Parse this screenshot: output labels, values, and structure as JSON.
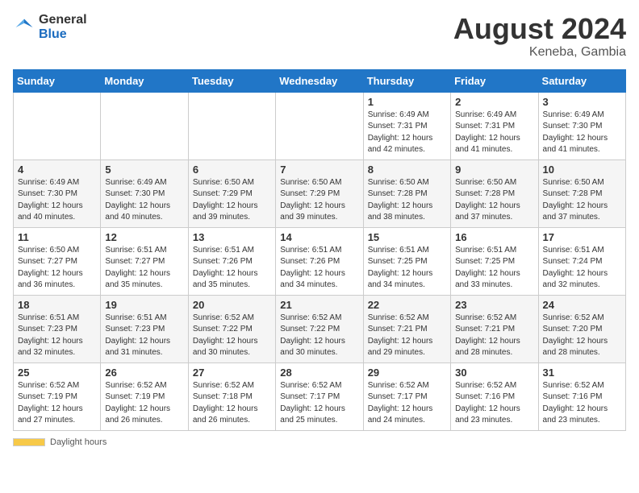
{
  "header": {
    "logo_general": "General",
    "logo_blue": "Blue",
    "month_year": "August 2024",
    "location": "Keneba, Gambia"
  },
  "days_of_week": [
    "Sunday",
    "Monday",
    "Tuesday",
    "Wednesday",
    "Thursday",
    "Friday",
    "Saturday"
  ],
  "footer_label": "Daylight hours",
  "weeks": [
    [
      {
        "day": "",
        "text": ""
      },
      {
        "day": "",
        "text": ""
      },
      {
        "day": "",
        "text": ""
      },
      {
        "day": "",
        "text": ""
      },
      {
        "day": "1",
        "text": "Sunrise: 6:49 AM\nSunset: 7:31 PM\nDaylight: 12 hours and 42 minutes."
      },
      {
        "day": "2",
        "text": "Sunrise: 6:49 AM\nSunset: 7:31 PM\nDaylight: 12 hours and 41 minutes."
      },
      {
        "day": "3",
        "text": "Sunrise: 6:49 AM\nSunset: 7:30 PM\nDaylight: 12 hours and 41 minutes."
      }
    ],
    [
      {
        "day": "4",
        "text": "Sunrise: 6:49 AM\nSunset: 7:30 PM\nDaylight: 12 hours and 40 minutes."
      },
      {
        "day": "5",
        "text": "Sunrise: 6:49 AM\nSunset: 7:30 PM\nDaylight: 12 hours and 40 minutes."
      },
      {
        "day": "6",
        "text": "Sunrise: 6:50 AM\nSunset: 7:29 PM\nDaylight: 12 hours and 39 minutes."
      },
      {
        "day": "7",
        "text": "Sunrise: 6:50 AM\nSunset: 7:29 PM\nDaylight: 12 hours and 39 minutes."
      },
      {
        "day": "8",
        "text": "Sunrise: 6:50 AM\nSunset: 7:28 PM\nDaylight: 12 hours and 38 minutes."
      },
      {
        "day": "9",
        "text": "Sunrise: 6:50 AM\nSunset: 7:28 PM\nDaylight: 12 hours and 37 minutes."
      },
      {
        "day": "10",
        "text": "Sunrise: 6:50 AM\nSunset: 7:28 PM\nDaylight: 12 hours and 37 minutes."
      }
    ],
    [
      {
        "day": "11",
        "text": "Sunrise: 6:50 AM\nSunset: 7:27 PM\nDaylight: 12 hours and 36 minutes."
      },
      {
        "day": "12",
        "text": "Sunrise: 6:51 AM\nSunset: 7:27 PM\nDaylight: 12 hours and 35 minutes."
      },
      {
        "day": "13",
        "text": "Sunrise: 6:51 AM\nSunset: 7:26 PM\nDaylight: 12 hours and 35 minutes."
      },
      {
        "day": "14",
        "text": "Sunrise: 6:51 AM\nSunset: 7:26 PM\nDaylight: 12 hours and 34 minutes."
      },
      {
        "day": "15",
        "text": "Sunrise: 6:51 AM\nSunset: 7:25 PM\nDaylight: 12 hours and 34 minutes."
      },
      {
        "day": "16",
        "text": "Sunrise: 6:51 AM\nSunset: 7:25 PM\nDaylight: 12 hours and 33 minutes."
      },
      {
        "day": "17",
        "text": "Sunrise: 6:51 AM\nSunset: 7:24 PM\nDaylight: 12 hours and 32 minutes."
      }
    ],
    [
      {
        "day": "18",
        "text": "Sunrise: 6:51 AM\nSunset: 7:23 PM\nDaylight: 12 hours and 32 minutes."
      },
      {
        "day": "19",
        "text": "Sunrise: 6:51 AM\nSunset: 7:23 PM\nDaylight: 12 hours and 31 minutes."
      },
      {
        "day": "20",
        "text": "Sunrise: 6:52 AM\nSunset: 7:22 PM\nDaylight: 12 hours and 30 minutes."
      },
      {
        "day": "21",
        "text": "Sunrise: 6:52 AM\nSunset: 7:22 PM\nDaylight: 12 hours and 30 minutes."
      },
      {
        "day": "22",
        "text": "Sunrise: 6:52 AM\nSunset: 7:21 PM\nDaylight: 12 hours and 29 minutes."
      },
      {
        "day": "23",
        "text": "Sunrise: 6:52 AM\nSunset: 7:21 PM\nDaylight: 12 hours and 28 minutes."
      },
      {
        "day": "24",
        "text": "Sunrise: 6:52 AM\nSunset: 7:20 PM\nDaylight: 12 hours and 28 minutes."
      }
    ],
    [
      {
        "day": "25",
        "text": "Sunrise: 6:52 AM\nSunset: 7:19 PM\nDaylight: 12 hours and 27 minutes."
      },
      {
        "day": "26",
        "text": "Sunrise: 6:52 AM\nSunset: 7:19 PM\nDaylight: 12 hours and 26 minutes."
      },
      {
        "day": "27",
        "text": "Sunrise: 6:52 AM\nSunset: 7:18 PM\nDaylight: 12 hours and 26 minutes."
      },
      {
        "day": "28",
        "text": "Sunrise: 6:52 AM\nSunset: 7:17 PM\nDaylight: 12 hours and 25 minutes."
      },
      {
        "day": "29",
        "text": "Sunrise: 6:52 AM\nSunset: 7:17 PM\nDaylight: 12 hours and 24 minutes."
      },
      {
        "day": "30",
        "text": "Sunrise: 6:52 AM\nSunset: 7:16 PM\nDaylight: 12 hours and 23 minutes."
      },
      {
        "day": "31",
        "text": "Sunrise: 6:52 AM\nSunset: 7:16 PM\nDaylight: 12 hours and 23 minutes."
      }
    ]
  ]
}
